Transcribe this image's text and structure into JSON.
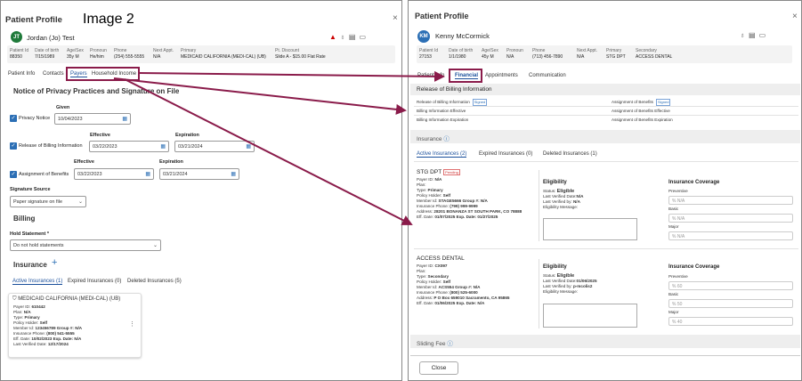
{
  "left": {
    "title": "Patient Profile",
    "image_label": "Image 2",
    "close": "×",
    "avatar": "JT",
    "patient_name": "Jordan (Jo) Test",
    "info": [
      {
        "k": "Patient Id",
        "v": "88350"
      },
      {
        "k": "Date of birth",
        "v": "7/15/1989"
      },
      {
        "k": "Age/Sex",
        "v": "35y M"
      },
      {
        "k": "Pronoun",
        "v": "He/him"
      },
      {
        "k": "Phone",
        "v": "(254) 555-5555"
      },
      {
        "k": "Next Appt.",
        "v": "N/A"
      },
      {
        "k": "Primary",
        "v": "MEDICAID CALIFORNIA (MEDI-CAL) (UB)"
      },
      {
        "k": "Pt. Discount",
        "v": "Slide A - $15.00 Flat Rate"
      }
    ],
    "tabs": [
      "Patient Info",
      "Contacts",
      "Payers",
      "Household Income"
    ],
    "notice_title": "Notice of Privacy Practices and Signature on File",
    "given_label": "Given",
    "privacy_label": "Privacy Notice",
    "privacy_date": "10/04/2023",
    "effective_label": "Effective",
    "expiration_label": "Expiration",
    "release_label": "Release of Billing Information",
    "release_eff": "03/22/2023",
    "release_exp": "03/21/2024",
    "assign_label": "Assignment of Benefits",
    "assign_eff": "03/22/2023",
    "assign_exp": "03/21/2024",
    "sig_source_label": "Signature Source",
    "sig_source_value": "Paper signature on file",
    "billing_title": "Billing",
    "hold_label": "Hold Statement *",
    "hold_value": "Do not hold statements",
    "insurance_title": "Insurance",
    "plus": "+",
    "ins_tabs": [
      "Active Insurances (1)",
      "Expired Insurances (0)",
      "Deleted Insurances (5)"
    ],
    "card": {
      "name": "MEDICAID CALIFORNIA (MEDI-CAL) (UB)",
      "lines": [
        {
          "k": "Payer ID:",
          "v": "610442"
        },
        {
          "k": "Plan:",
          "v": "N/A"
        },
        {
          "k": "Type:",
          "v": "Primary"
        },
        {
          "k": "Policy Holder:",
          "v": "Self"
        },
        {
          "k": "Member Id:",
          "v": "123456789   Group #: N/A"
        },
        {
          "k": "Insurance Phone:",
          "v": "(800) 541-5555"
        },
        {
          "k": "Eff. Date:",
          "v": "10/02/2023   Exp. Date: N/A"
        },
        {
          "k": "Last Verified Date:",
          "v": "12/17/2024"
        }
      ]
    }
  },
  "right": {
    "title": "Patient Profile",
    "close": "×",
    "avatar": "KM",
    "patient_name": "Kenny McCormick",
    "info": [
      {
        "k": "Patient Id",
        "v": "27153"
      },
      {
        "k": "Date of birth",
        "v": "1/1/1980"
      },
      {
        "k": "Age/Sex",
        "v": "45y M"
      },
      {
        "k": "Pronoun",
        "v": "N/A"
      },
      {
        "k": "Phone",
        "v": "(713) 456-7890"
      },
      {
        "k": "Next Appt.",
        "v": "N/A"
      },
      {
        "k": "Primary",
        "v": "STG DPT"
      },
      {
        "k": "Secondary",
        "v": "ACCESS DENTAL"
      }
    ],
    "tabs": [
      "Patient Info",
      "Financial",
      "Appointments",
      "Communication"
    ],
    "release_title": "Release of Billing Information",
    "rows": [
      {
        "l": "Release of Billing Information",
        "r": "Assignment of Benefits"
      },
      {
        "l": "Billing Information Effective",
        "r": "Assignment of Benefits Effective"
      },
      {
        "l": "Billing Information Expiration",
        "r": "Assignment of Benefits Expiration"
      }
    ],
    "signed": "Signed",
    "insurance_title": "Insurance",
    "ins_tabs": [
      "Active Insurances (2)",
      "Expired Insurances (0)",
      "Deleted Insurances (1)"
    ],
    "elig_title": "Eligibility",
    "cov_title": "Insurance Coverage",
    "cov_labels": [
      "Preventive",
      "Basic",
      "Major"
    ],
    "ins1": {
      "name": "STG DPT",
      "pending": "Pending",
      "lines": [
        {
          "k": "Payer ID:",
          "v": "N/A"
        },
        {
          "k": "Plan:",
          "v": ""
        },
        {
          "k": "Type:",
          "v": "Primary"
        },
        {
          "k": "Policy Holder:",
          "v": "Self"
        },
        {
          "k": "Member Id:",
          "v": "STAGE5666   Group #: N/A"
        },
        {
          "k": "Insurance Phone:",
          "v": "(799) 999-9999"
        },
        {
          "k": "Address:",
          "v": "28201 BONANZA ST SOUTH PARK, CO 78888"
        },
        {
          "k": "Eff. Date:",
          "v": "01/07/2025   Exp. Date: 01/27/2025"
        }
      ],
      "status": "Eligible",
      "last_verified_date": "N/A",
      "last_verified_by": "N/A",
      "cov": [
        "% N/A",
        "% N/A",
        "% N/A"
      ]
    },
    "ins2": {
      "name": "ACCESS DENTAL",
      "lines": [
        {
          "k": "Payer ID:",
          "v": "CX097"
        },
        {
          "k": "Plan:",
          "v": ""
        },
        {
          "k": "Type:",
          "v": "Secondary"
        },
        {
          "k": "Policy Holder:",
          "v": "Self"
        },
        {
          "k": "Member Id:",
          "v": "ACS554   Group #: N/A"
        },
        {
          "k": "Insurance Phone:",
          "v": "(800) 525-6000"
        },
        {
          "k": "Address:",
          "v": "P O Box 659010 Sacramento, CA 95865"
        },
        {
          "k": "Eff. Date:",
          "v": "01/06/2025   Exp. Date: N/A"
        }
      ],
      "status": "Eligible",
      "last_verified_date": "01/06/2025",
      "last_verified_by": "p-mcolis2",
      "cov": [
        "% 60",
        "% 50",
        "% 40"
      ]
    },
    "status_label": "Status:",
    "lvd_label": "Last Verified Date:",
    "lvb_label": "Last Verified by:",
    "em_label": "Eligibility Message:",
    "sliding_title": "Sliding Fee",
    "close_btn": "Close"
  },
  "colors": {
    "accent": "#2c6fb5",
    "highlight": "#8a1b4a",
    "arrow": "#8a1b4a",
    "avatar_left": "#1f7a3a",
    "avatar_right": "#2c6fb5"
  }
}
